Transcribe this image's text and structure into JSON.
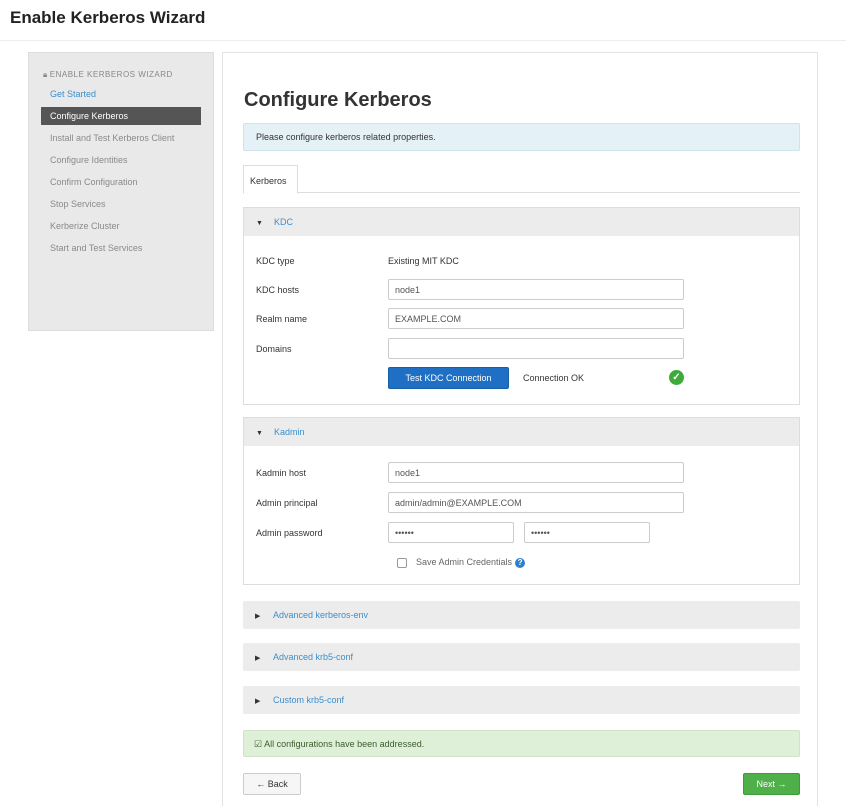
{
  "page_title": "Enable Kerberos Wizard",
  "sidebar": {
    "header": "ENABLE KERBEROS WIZARD",
    "items": [
      {
        "label": "Get Started"
      },
      {
        "label": "Configure Kerberos"
      },
      {
        "label": "Install and Test Kerberos Client"
      },
      {
        "label": "Configure Identities"
      },
      {
        "label": "Confirm Configuration"
      },
      {
        "label": "Stop Services"
      },
      {
        "label": "Kerberize Cluster"
      },
      {
        "label": "Start and Test Services"
      }
    ]
  },
  "main": {
    "title": "Configure Kerberos",
    "info": "Please configure kerberos related properties.",
    "tabs": [
      {
        "label": "Kerberos"
      }
    ]
  },
  "kdc": {
    "heading": "KDC",
    "type_label": "KDC type",
    "type_value": "Existing MIT KDC",
    "hosts_label": "KDC hosts",
    "hosts_value": "node1",
    "realm_label": "Realm name",
    "realm_value": "EXAMPLE.COM",
    "domains_label": "Domains",
    "domains_value": "",
    "test_button": "Test KDC Connection",
    "connection_status": "Connection OK"
  },
  "kadmin": {
    "heading": "Kadmin",
    "host_label": "Kadmin host",
    "host_value": "node1",
    "principal_label": "Admin principal",
    "principal_value": "admin/admin@EXAMPLE.COM",
    "password_label": "Admin password",
    "password_value": "••••••",
    "password_confirm_value": "••••••",
    "save_credentials_label": "Save Admin Credentials"
  },
  "sections": [
    {
      "label": "Advanced kerberos-env"
    },
    {
      "label": "Advanced krb5-conf"
    },
    {
      "label": "Custom krb5-conf"
    }
  ],
  "success_message": "All configurations have been addressed.",
  "footer": {
    "back_label": "← Back",
    "next_label": "Next →"
  },
  "icons": {
    "caret_down": "caret-down-icon",
    "caret_right": "caret-right-icon",
    "check": "check-circle-icon",
    "help": "help-icon"
  },
  "colors": {
    "link": "#3a8fcf",
    "primary_button": "#1f70c4",
    "next_button": "#4fb04a",
    "success_bg": "#dff0d8",
    "info_bg": "#e4f1f7",
    "active_sidebar": "#555555"
  }
}
